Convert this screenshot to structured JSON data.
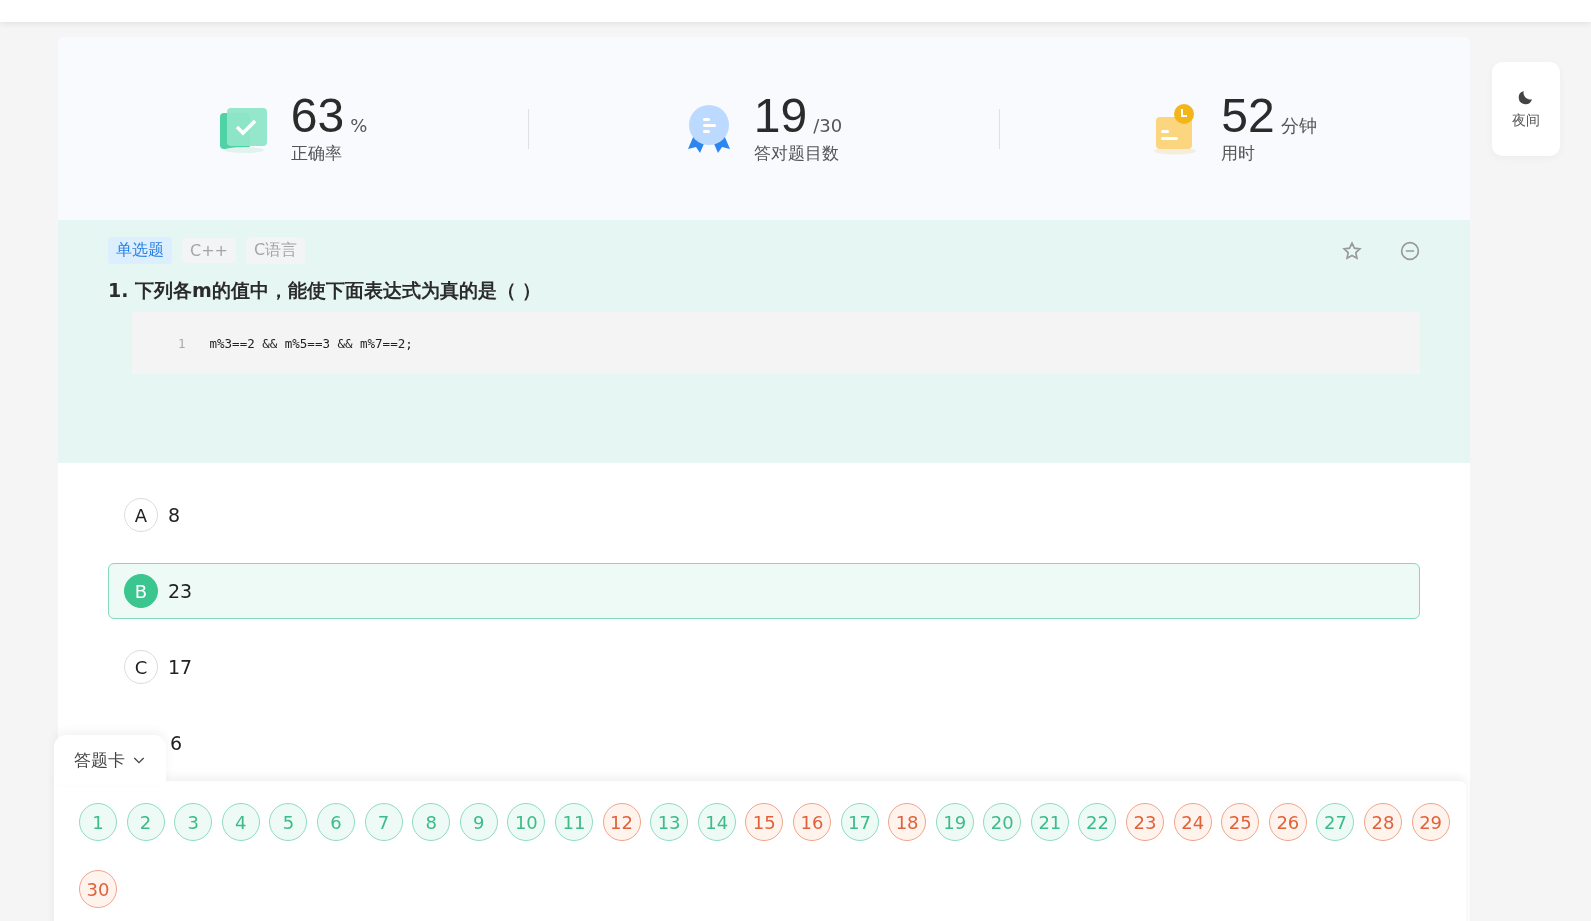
{
  "stats": [
    {
      "kind": "accuracy",
      "value": "63",
      "unit": "%",
      "label": "正确率"
    },
    {
      "kind": "correct",
      "value": "19",
      "unit": "/30",
      "label": "答对题目数"
    },
    {
      "kind": "time",
      "value": "52",
      "unit": "分钟",
      "label": "用时"
    }
  ],
  "night_mode": {
    "label": "夜间"
  },
  "question": {
    "tags": [
      {
        "kind": "type",
        "label": "单选题"
      },
      {
        "kind": "topic",
        "label": "C++"
      },
      {
        "kind": "topic",
        "label": "C语言"
      }
    ],
    "title": "1. 下列各m的值中，能使下面表达式为真的是（ ）",
    "code": [
      {
        "number": "1",
        "text": "m%3==2 && m%5==3 && m%7==2;"
      }
    ],
    "options": [
      {
        "letter": "A",
        "text": "8",
        "selected": false
      },
      {
        "letter": "B",
        "text": "23",
        "selected": true
      },
      {
        "letter": "C",
        "text": "17",
        "selected": false
      },
      {
        "text": "6",
        "selected": false
      }
    ]
  },
  "answer_card": {
    "title": "答题卡",
    "items": [
      {
        "label": "1",
        "correct": true
      },
      {
        "label": "2",
        "correct": true
      },
      {
        "label": "3",
        "correct": true
      },
      {
        "label": "4",
        "correct": true
      },
      {
        "label": "5",
        "correct": true
      },
      {
        "label": "6",
        "correct": true
      },
      {
        "label": "7",
        "correct": true
      },
      {
        "label": "8",
        "correct": true
      },
      {
        "label": "9",
        "correct": true
      },
      {
        "label": "10",
        "correct": true
      },
      {
        "label": "11",
        "correct": true
      },
      {
        "label": "12",
        "correct": false
      },
      {
        "label": "13",
        "correct": true
      },
      {
        "label": "14",
        "correct": true
      },
      {
        "label": "15",
        "correct": false
      },
      {
        "label": "16",
        "correct": false
      },
      {
        "label": "17",
        "correct": true
      },
      {
        "label": "18",
        "correct": false
      },
      {
        "label": "19",
        "correct": true
      },
      {
        "label": "20",
        "correct": true
      },
      {
        "label": "21",
        "correct": true
      },
      {
        "label": "22",
        "correct": true
      },
      {
        "label": "23",
        "correct": false
      },
      {
        "label": "24",
        "correct": false
      },
      {
        "label": "25",
        "correct": false
      },
      {
        "label": "26",
        "correct": false
      },
      {
        "label": "27",
        "correct": true
      },
      {
        "label": "28",
        "correct": false
      },
      {
        "label": "29",
        "correct": false
      },
      {
        "label": "30",
        "correct": false
      }
    ]
  }
}
